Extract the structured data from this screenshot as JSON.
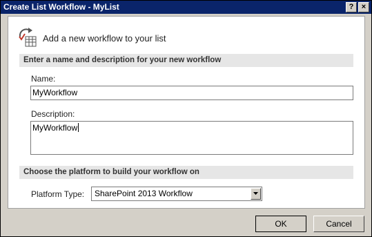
{
  "window": {
    "title": "Create List Workflow - MyList",
    "help_label": "?",
    "close_label": "×"
  },
  "header": {
    "text": "Add a new workflow to your list",
    "icon": "workflow-icon"
  },
  "section_name": {
    "title": "Enter a name and description for your new workflow"
  },
  "name_field": {
    "label": "Name:",
    "value": "MyWorkflow"
  },
  "description_field": {
    "label": "Description:",
    "value": "MyWorkflow"
  },
  "section_platform": {
    "title": "Choose the platform to build your workflow on"
  },
  "platform_field": {
    "label": "Platform Type:",
    "value": "SharePoint 2013 Workflow"
  },
  "buttons": {
    "ok_label": "OK",
    "cancel_label": "Cancel"
  }
}
